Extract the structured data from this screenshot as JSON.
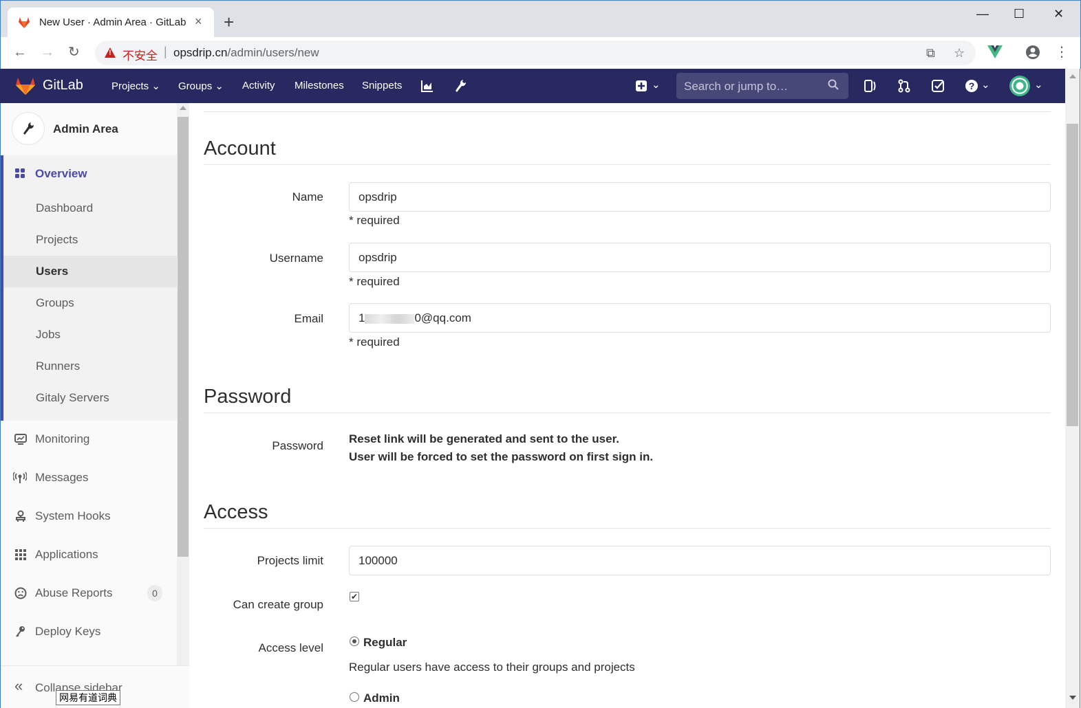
{
  "browser": {
    "tab_title": "New User · Admin Area · GitLab",
    "tab_close": "×",
    "new_tab": "+",
    "win_min": "—",
    "win_max": "☐",
    "win_close": "✕",
    "back": "←",
    "forward": "→",
    "reload": "↻",
    "insecure_label": "不安全",
    "url_host": "opsdrip.cn",
    "url_path": "/admin/users/new",
    "translate_icon": "⧉",
    "bookmark_icon": "☆",
    "menu_icon": "⋮"
  },
  "header": {
    "brand": "GitLab",
    "nav": [
      "Projects",
      "Groups",
      "Activity",
      "Milestones",
      "Snippets"
    ],
    "search_placeholder": "Search or jump to…",
    "chevron": "⌄"
  },
  "sidebar": {
    "title": "Admin Area",
    "overview_label": "Overview",
    "overview_items": [
      "Dashboard",
      "Projects",
      "Users",
      "Groups",
      "Jobs",
      "Runners",
      "Gitaly Servers"
    ],
    "active_item": "Users",
    "items": [
      {
        "label": "Monitoring",
        "icon": "monitor-icon"
      },
      {
        "label": "Messages",
        "icon": "broadcast-icon"
      },
      {
        "label": "System Hooks",
        "icon": "hook-icon"
      },
      {
        "label": "Applications",
        "icon": "apps-grid-icon"
      },
      {
        "label": "Abuse Reports",
        "icon": "frown-icon",
        "badge": "0"
      },
      {
        "label": "Deploy Keys",
        "icon": "key-icon"
      }
    ],
    "collapse_label": "Collapse sidebar",
    "tooltip": "网易有道词典"
  },
  "account": {
    "title": "Account",
    "name_label": "Name",
    "name_value": "opsdrip",
    "username_label": "Username",
    "username_value": "opsdrip",
    "email_label": "Email",
    "email_prefix": "1",
    "email_suffix": "0@qq.com",
    "required": "* required"
  },
  "password": {
    "title": "Password",
    "label": "Password",
    "line1": "Reset link will be generated and sent to the user.",
    "line2": "User will be forced to set the password on first sign in."
  },
  "access": {
    "title": "Access",
    "projects_limit_label": "Projects limit",
    "projects_limit_value": "100000",
    "can_create_group_label": "Can create group",
    "can_create_group_checked": true,
    "access_level_label": "Access level",
    "regular_label": "Regular",
    "regular_help": "Regular users have access to their groups and projects",
    "admin_label": "Admin",
    "selected": "Regular"
  },
  "colors": {
    "header_bg": "#292961",
    "accent": "#4b4ba3",
    "insecure": "#c5221f"
  }
}
